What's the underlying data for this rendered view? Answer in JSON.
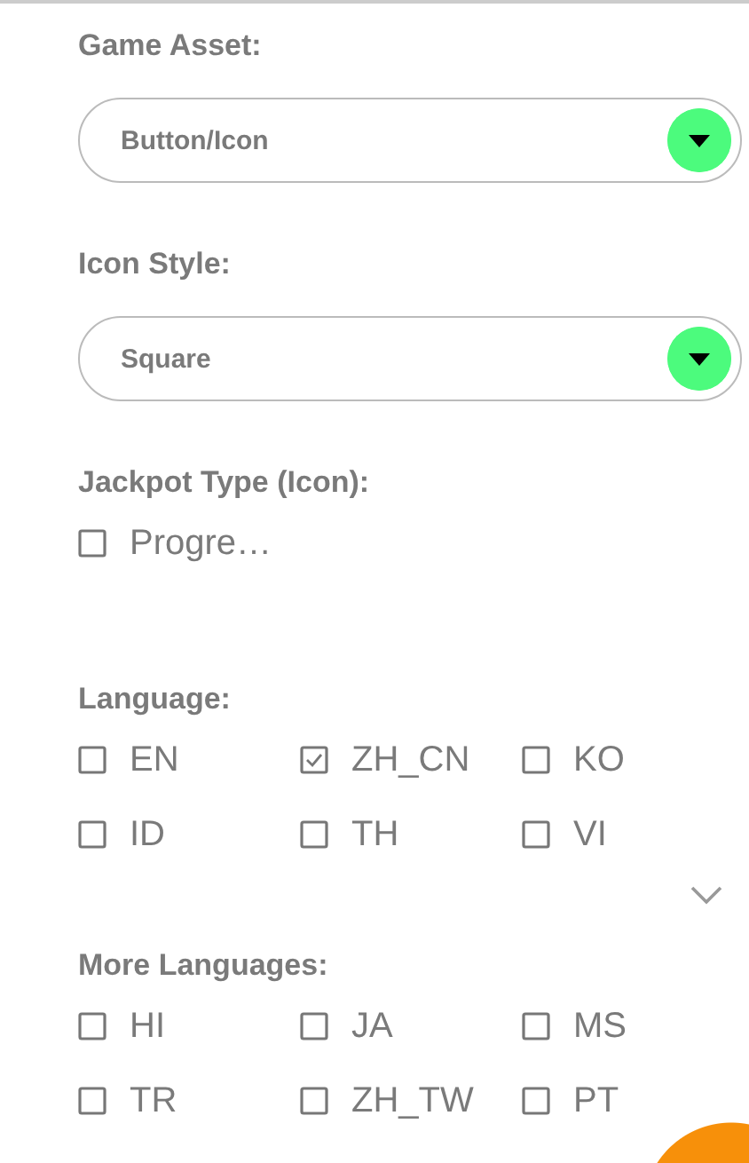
{
  "fields": [
    {
      "kind": "select",
      "label": "Game Asset:",
      "value": "Button/Icon"
    },
    {
      "kind": "select",
      "label": "Icon Style:",
      "value": "Square"
    },
    {
      "kind": "checks",
      "label": "Jackpot Type (Icon):",
      "options": [
        {
          "label": "Progre…",
          "checked": false
        }
      ]
    },
    {
      "kind": "checks",
      "label": "Language:",
      "expand": true,
      "options": [
        {
          "label": "EN",
          "checked": false
        },
        {
          "label": "ZH_CN",
          "checked": true
        },
        {
          "label": "KO",
          "checked": false
        },
        {
          "label": "ID",
          "checked": false
        },
        {
          "label": "TH",
          "checked": false
        },
        {
          "label": "VI",
          "checked": false
        }
      ]
    },
    {
      "kind": "checks",
      "label": "More Languages:",
      "options": [
        {
          "label": "HI",
          "checked": false
        },
        {
          "label": "JA",
          "checked": false
        },
        {
          "label": "MS",
          "checked": false
        },
        {
          "label": "TR",
          "checked": false
        },
        {
          "label": "ZH_TW",
          "checked": false
        },
        {
          "label": "PT",
          "checked": false
        }
      ]
    }
  ]
}
